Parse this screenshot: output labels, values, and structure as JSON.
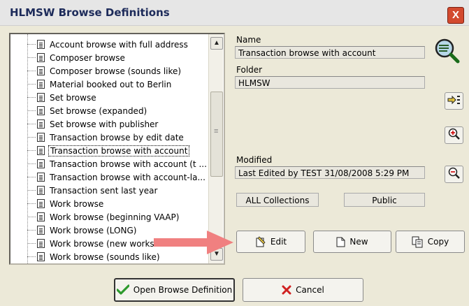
{
  "window": {
    "title": "HLMSW Browse Definitions",
    "close_label": "X"
  },
  "tree": {
    "items": [
      {
        "label": "Account browse with full address"
      },
      {
        "label": "Composer browse"
      },
      {
        "label": "Composer browse (sounds like)"
      },
      {
        "label": "Material booked out to Berlin"
      },
      {
        "label": "Set browse"
      },
      {
        "label": "Set browse (expanded)"
      },
      {
        "label": "Set browse with publisher"
      },
      {
        "label": "Transaction browse by edit date"
      },
      {
        "label": "Transaction browse with account"
      },
      {
        "label": "Transaction browse with account (t ..."
      },
      {
        "label": "Transaction browse with account-la..."
      },
      {
        "label": "Transaction sent last year"
      },
      {
        "label": "Work browse"
      },
      {
        "label": "Work browse (beginning VAAP)"
      },
      {
        "label": "Work browse (LONG)"
      },
      {
        "label": "Work browse (new works"
      },
      {
        "label": "Work browse (sounds like)"
      }
    ],
    "selected_index": 8
  },
  "details": {
    "name_label": "Name",
    "name_value": "Transaction browse with account",
    "folder_label": "Folder",
    "folder_value": "HLMSW",
    "modified_label": "Modified",
    "modified_value": "Last Edited by TEST 31/08/2008 5:29 PM",
    "collections_value": "ALL Collections",
    "visibility_value": "Public"
  },
  "actions": {
    "edit_label": "Edit",
    "new_label": "New",
    "copy_label": "Copy"
  },
  "footer": {
    "open_label": "Open Browse Definition",
    "cancel_label": "Cancel"
  },
  "icons": [
    "search-icon",
    "pointer-list-icon",
    "zoom-in-icon",
    "zoom-out-icon",
    "edit-icon",
    "new-icon",
    "copy-icon",
    "check-icon",
    "cancel-x-icon",
    "red-arrow-icon"
  ],
  "colors": {
    "arrow": "#f08080",
    "title_text": "#1d2b5a",
    "close_button": "#d34a2f",
    "check": "#2e9a2e",
    "cancel_x": "#d02020"
  }
}
